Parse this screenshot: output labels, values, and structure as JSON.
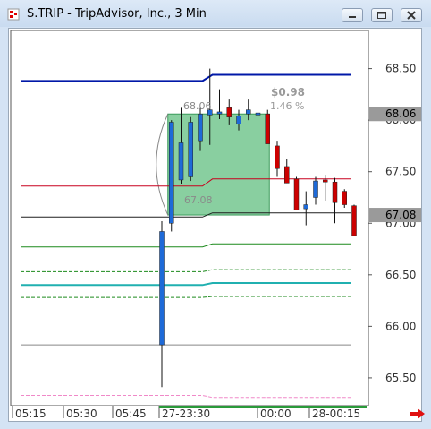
{
  "window": {
    "title": "S.TRIP - TripAdvisor, Inc., 3 Min",
    "icon": "candlestick-chart-icon",
    "buttons": [
      "minimize-icon",
      "restore-icon",
      "close-icon"
    ]
  },
  "colors": {
    "upper_band": "#0018a8",
    "mid_band": "#c8001e",
    "lower_band": "#1c8a1c",
    "bull_candle": "#1e6ad8",
    "bear_candle": "#cc0000",
    "box_fill": "#5cbc7c",
    "cyan_line": "#20b0b0",
    "pink_line": "#f088c8",
    "price_highlight": "#9a9a9a"
  },
  "chart_data": {
    "type": "candlestick",
    "y_ticks": [
      "68.50",
      "68.00",
      "67.50",
      "67.00",
      "66.50",
      "66.00",
      "65.50"
    ],
    "y_tick_values": [
      68.5,
      68.0,
      67.5,
      67.0,
      66.5,
      66.0,
      65.5
    ],
    "ylim": [
      65.23,
      68.87
    ],
    "x_ticks": [
      "05:15",
      "05:30",
      "05:45",
      "27-23:30",
      "00:00",
      "28-00:15"
    ],
    "price_labels": [
      "68.06",
      "67.08"
    ],
    "annotations": {
      "change": "$0.98",
      "change_pct": "1.46 %",
      "box_high": "68.06",
      "box_low": "67.08"
    },
    "candles": [
      {
        "o": 65.82,
        "h": 67.02,
        "l": 65.41,
        "c": 66.92
      },
      {
        "o": 67.0,
        "h": 68.0,
        "l": 66.92,
        "c": 67.98
      },
      {
        "o": 67.42,
        "h": 68.12,
        "l": 67.38,
        "c": 67.78
      },
      {
        "o": 67.45,
        "h": 68.03,
        "l": 67.41,
        "c": 67.98
      },
      {
        "o": 67.8,
        "h": 68.12,
        "l": 67.7,
        "c": 68.06
      },
      {
        "o": 68.05,
        "h": 68.5,
        "l": 67.76,
        "c": 68.1
      },
      {
        "o": 68.06,
        "h": 68.3,
        "l": 68.01,
        "c": 68.08
      },
      {
        "o": 68.12,
        "h": 68.2,
        "l": 67.95,
        "c": 68.03
      },
      {
        "o": 67.96,
        "h": 68.1,
        "l": 67.9,
        "c": 68.04
      },
      {
        "o": 68.06,
        "h": 68.2,
        "l": 68.0,
        "c": 68.1
      },
      {
        "o": 68.05,
        "h": 68.28,
        "l": 67.97,
        "c": 68.07
      },
      {
        "o": 68.06,
        "h": 68.1,
        "l": 67.78,
        "c": 67.77
      },
      {
        "o": 67.75,
        "h": 67.8,
        "l": 67.45,
        "c": 67.53
      },
      {
        "o": 67.55,
        "h": 67.62,
        "l": 67.39,
        "c": 67.39
      },
      {
        "o": 67.43,
        "h": 67.45,
        "l": 67.13,
        "c": 67.13
      },
      {
        "o": 67.14,
        "h": 67.31,
        "l": 66.98,
        "c": 67.18
      },
      {
        "o": 67.25,
        "h": 67.45,
        "l": 67.18,
        "c": 67.41
      },
      {
        "o": 67.42,
        "h": 67.47,
        "l": 67.22,
        "c": 67.4
      },
      {
        "o": 67.4,
        "h": 67.44,
        "l": 67.0,
        "c": 67.2
      },
      {
        "o": 67.31,
        "h": 67.33,
        "l": 67.15,
        "c": 67.18
      },
      {
        "o": 67.17,
        "h": 67.18,
        "l": 66.88,
        "c": 66.88
      }
    ],
    "lines": [
      {
        "color": "#0018a8",
        "width": 2,
        "values": [
          [
            0,
            68.38
          ],
          [
            0.55,
            68.38
          ],
          [
            0.58,
            68.44
          ],
          [
            1,
            68.44
          ]
        ]
      },
      {
        "color": "#c8001e",
        "width": 1,
        "values": [
          [
            0,
            67.36
          ],
          [
            0.55,
            67.36
          ],
          [
            0.58,
            67.43
          ],
          [
            1,
            67.43
          ]
        ]
      },
      {
        "color": "#1e1e1e",
        "width": 1,
        "values": [
          [
            0,
            67.06
          ],
          [
            0.55,
            67.06
          ],
          [
            0.58,
            67.1
          ],
          [
            1,
            67.1
          ]
        ]
      },
      {
        "color": "#1c8a1c",
        "width": 1,
        "values": [
          [
            0,
            66.77
          ],
          [
            0.55,
            66.77
          ],
          [
            0.58,
            66.8
          ],
          [
            1,
            66.8
          ]
        ]
      },
      {
        "color": "#20b0b0",
        "width": 2,
        "values": [
          [
            0,
            66.4
          ],
          [
            0.55,
            66.4
          ],
          [
            0.58,
            66.42
          ],
          [
            1,
            66.42
          ]
        ]
      },
      {
        "color": "#1c8a1c",
        "width": 1,
        "dash": true,
        "values": [
          [
            0,
            66.53
          ],
          [
            0.55,
            66.53
          ],
          [
            0.58,
            66.55
          ],
          [
            1,
            66.55
          ]
        ]
      },
      {
        "color": "#1c8a1c",
        "width": 1,
        "dash": true,
        "values": [
          [
            0,
            66.28
          ],
          [
            0.55,
            66.28
          ],
          [
            0.58,
            66.29
          ],
          [
            1,
            66.29
          ]
        ]
      },
      {
        "color": "#888888",
        "width": 1,
        "values": [
          [
            0,
            65.82
          ],
          [
            1,
            65.82
          ]
        ]
      },
      {
        "color": "#f088c8",
        "width": 1,
        "dash": true,
        "values": [
          [
            0,
            65.33
          ],
          [
            0.55,
            65.33
          ],
          [
            0.58,
            65.31
          ],
          [
            1,
            65.31
          ]
        ]
      }
    ]
  }
}
